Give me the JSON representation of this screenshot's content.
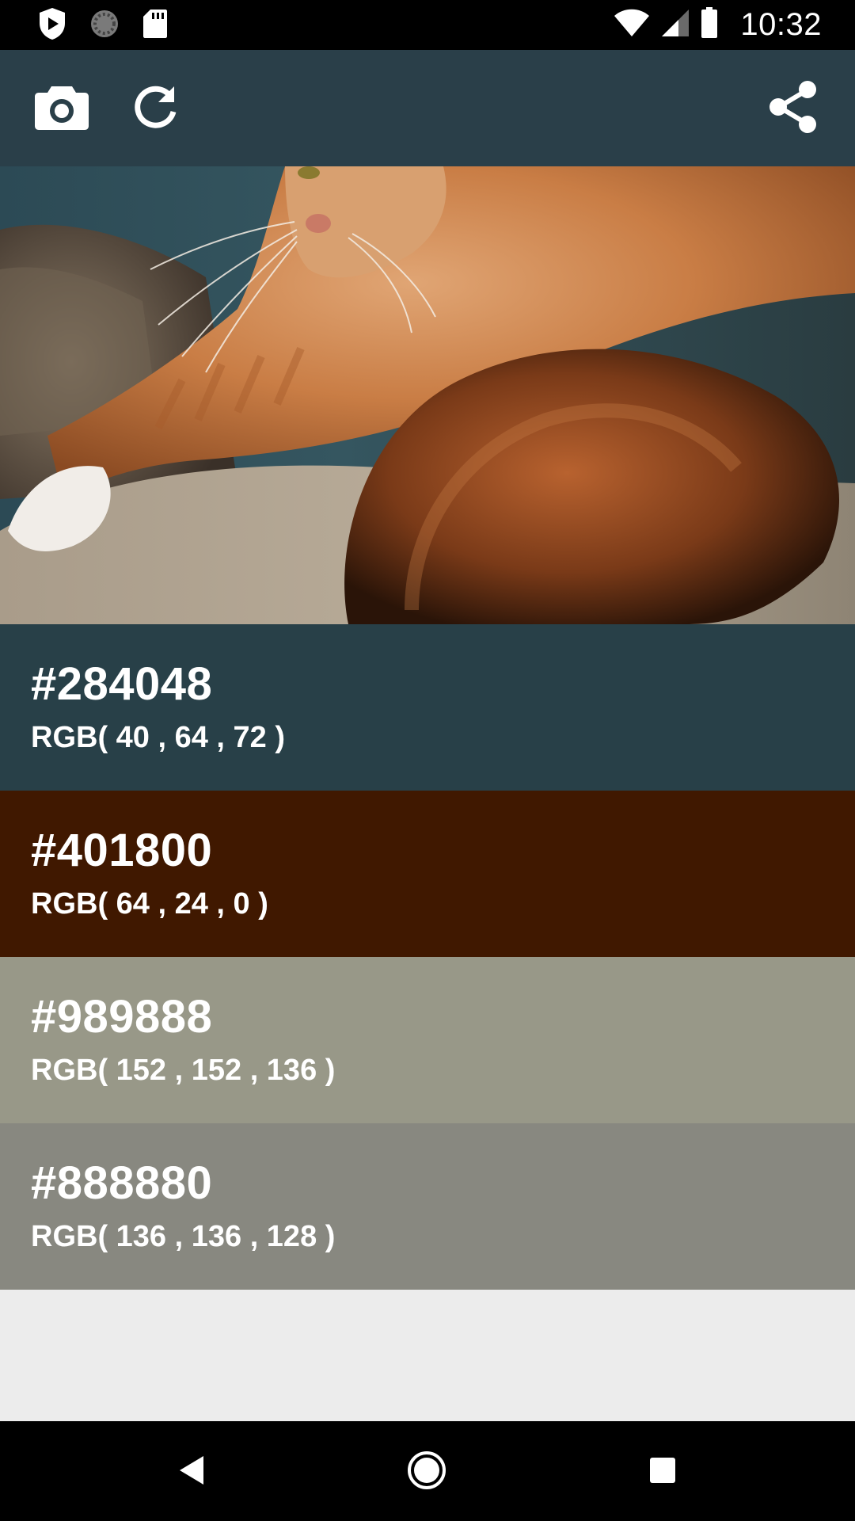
{
  "status_bar": {
    "time": "10:32",
    "left_icons": [
      "play-protect-icon",
      "loading-icon",
      "sd-card-icon"
    ],
    "right_icons": [
      "wifi-icon",
      "signal-icon",
      "battery-icon"
    ]
  },
  "toolbar": {
    "camera_icon": "camera-icon",
    "refresh_icon": "refresh-icon",
    "share_icon": "share-icon",
    "background": "#2a3f49"
  },
  "photo": {
    "subject": "cat-photo"
  },
  "swatches": [
    {
      "hex": "#284048",
      "rgb": "RGB( 40 , 64 , 72 )",
      "color": "#284048"
    },
    {
      "hex": "#401800",
      "rgb": "RGB( 64 , 24 , 0 )",
      "color": "#401800"
    },
    {
      "hex": "#989888",
      "rgb": "RGB( 152 , 152 , 136 )",
      "color": "#989888"
    },
    {
      "hex": "#888880",
      "rgb": "RGB( 136 , 136 , 128 )",
      "color": "#888880"
    }
  ],
  "nav_bar": {
    "back_icon": "back-icon",
    "home_icon": "home-icon",
    "recents_icon": "recents-icon"
  }
}
